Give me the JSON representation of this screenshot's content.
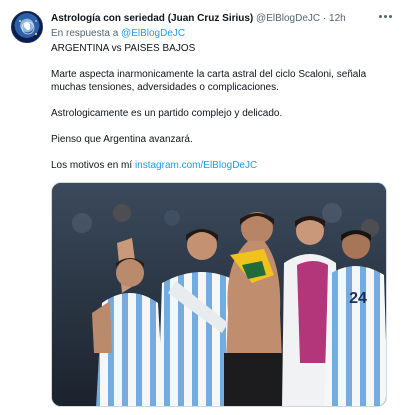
{
  "tweet": {
    "author": {
      "display_name": "Astrología con seriedad (Juan Cruz Sirius)",
      "handle": "@ElBlogDeJC",
      "separator": "·",
      "time": "12h",
      "avatar_icon": "astrology-logo-icon"
    },
    "reply": {
      "prefix": "En respuesta a",
      "handle": "@ElBlogDeJC"
    },
    "paragraphs": [
      "ARGENTINA vs PAISES BAJOS",
      "Marte aspecta inarmonicamente la carta astral del ciclo Scaloni, señala muchas tensiones, adversidades o complicaciones.",
      "Astrologicamente es un partido complejo y delicado.",
      "Pienso que Argentina avanzará."
    ],
    "motives": {
      "text": "Los motivos en mí",
      "link": "instagram.com/ElBlogDeJC"
    },
    "media": {
      "icon": "photo-football-players-celebrating",
      "jersey_number": "24"
    },
    "more_icon": "more-options-icon"
  },
  "colors": {
    "link": "#1d9bf0",
    "secondary_text": "#536471",
    "primary_text": "#0f1419",
    "jersey_blue": "#74acdf"
  }
}
